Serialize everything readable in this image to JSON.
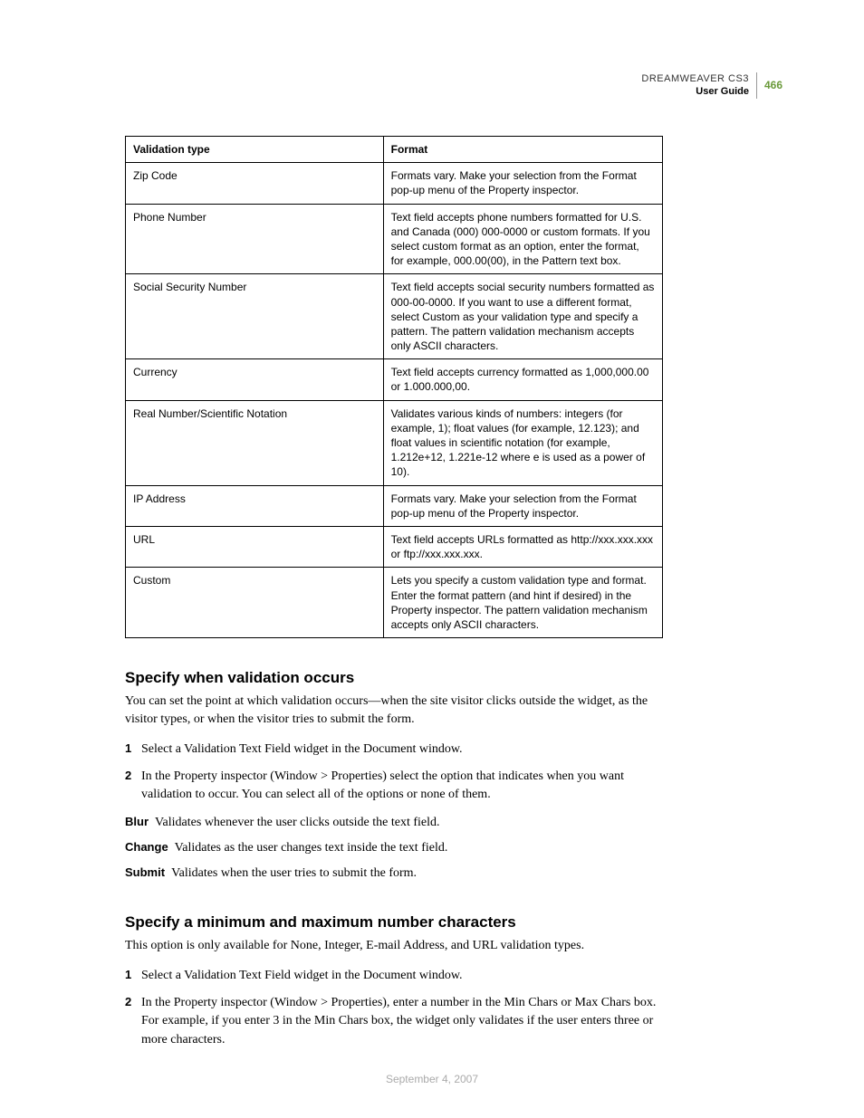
{
  "header": {
    "product": "DREAMWEAVER CS3",
    "guide": "User Guide",
    "page": "466"
  },
  "table": {
    "headers": [
      "Validation type",
      "Format"
    ],
    "rows": [
      {
        "type": "Zip Code",
        "format": "Formats vary. Make your selection from the Format pop-up menu of the Property inspector."
      },
      {
        "type": "Phone Number",
        "format": "Text field accepts phone numbers formatted for U.S. and Canada (000) 000-0000 or custom formats. If you select custom format as an option, enter the format, for example, 000.00(00), in the Pattern text box."
      },
      {
        "type": "Social Security Number",
        "format": "Text field accepts social security numbers formatted as 000-00-0000. If you want to use a different format, select Custom as your validation type and specify a pattern. The pattern validation mechanism accepts only ASCII characters."
      },
      {
        "type": "Currency",
        "format": "Text field accepts currency formatted as  1,000,000.00 or 1.000.000,00."
      },
      {
        "type": "Real Number/Scientific Notation",
        "format": "Validates various kinds of numbers: integers (for example, 1); float values (for example, 12.123); and float values in scientific notation (for example, 1.212e+12, 1.221e-12 where e is used as a power of 10)."
      },
      {
        "type": "IP Address",
        "format": "Formats vary. Make your selection from the Format pop-up menu of the Property inspector."
      },
      {
        "type": "URL",
        "format": "Text field accepts URLs formatted as http://xxx.xxx.xxx or ftp://xxx.xxx.xxx."
      },
      {
        "type": "Custom",
        "format": "Lets you specify a custom validation type and format. Enter the format pattern (and hint if desired) in the Property inspector. The pattern validation mechanism accepts only ASCII characters."
      }
    ]
  },
  "section1": {
    "title": "Specify when validation occurs",
    "intro": "You can set the point at which validation occurs—when the site visitor clicks outside the widget, as the visitor types, or when the visitor tries to submit the form.",
    "steps": [
      "Select a Validation Text Field widget in the Document window.",
      "In the Property inspector (Window > Properties) select the option that indicates when you want validation to occur. You can select all of the options or none of them."
    ],
    "defs": [
      {
        "term": "Blur",
        "text": "Validates whenever the user clicks outside the text field."
      },
      {
        "term": "Change",
        "text": "Validates as the user changes text inside the text field."
      },
      {
        "term": "Submit",
        "text": "Validates when the user tries to submit the form."
      }
    ]
  },
  "section2": {
    "title": "Specify a minimum and maximum number characters",
    "intro": "This option is only available for None, Integer, E-mail Address, and URL validation types.",
    "steps": [
      "Select a Validation Text Field widget in the Document window.",
      "In the Property inspector (Window > Properties), enter a number in the Min Chars or Max Chars box. For example, if you enter 3 in the Min Chars box, the widget only validates if the user enters three or more characters."
    ]
  },
  "footer": {
    "date": "September 4, 2007"
  }
}
